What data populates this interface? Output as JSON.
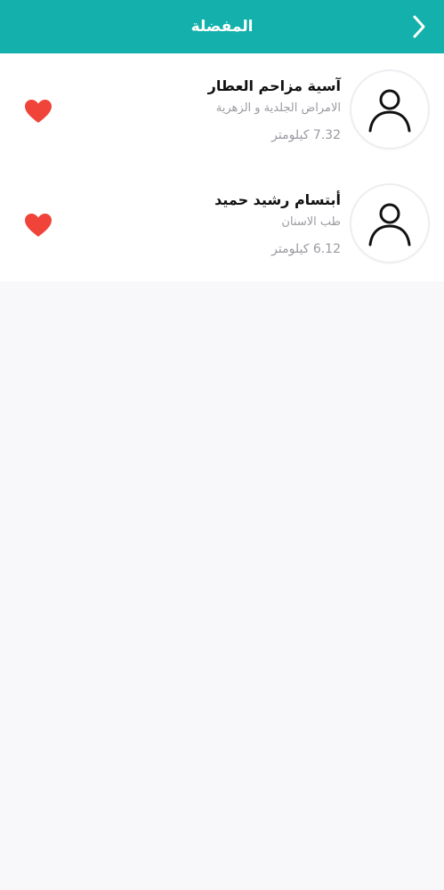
{
  "header": {
    "title": "المفضلة",
    "color": "#14b1ac"
  },
  "favorites": [
    {
      "name": "آسية مزاحم العطار",
      "specialty": "الامراض الجلدية و الزهرية",
      "distance": "7.32 كيلومتر",
      "avatar_icon": "user-outline-icon",
      "favorite_icon": "heart-filled-icon"
    },
    {
      "name": "أبتسام رشيد حميد",
      "specialty": "طب الاسنان",
      "distance": "6.12 كيلومتر",
      "avatar_icon": "user-outline-icon",
      "favorite_icon": "heart-filled-icon"
    }
  ],
  "colors": {
    "heart": "#f0433a",
    "secondary_text": "#9a9aa2",
    "background": "#f8f8fa"
  }
}
